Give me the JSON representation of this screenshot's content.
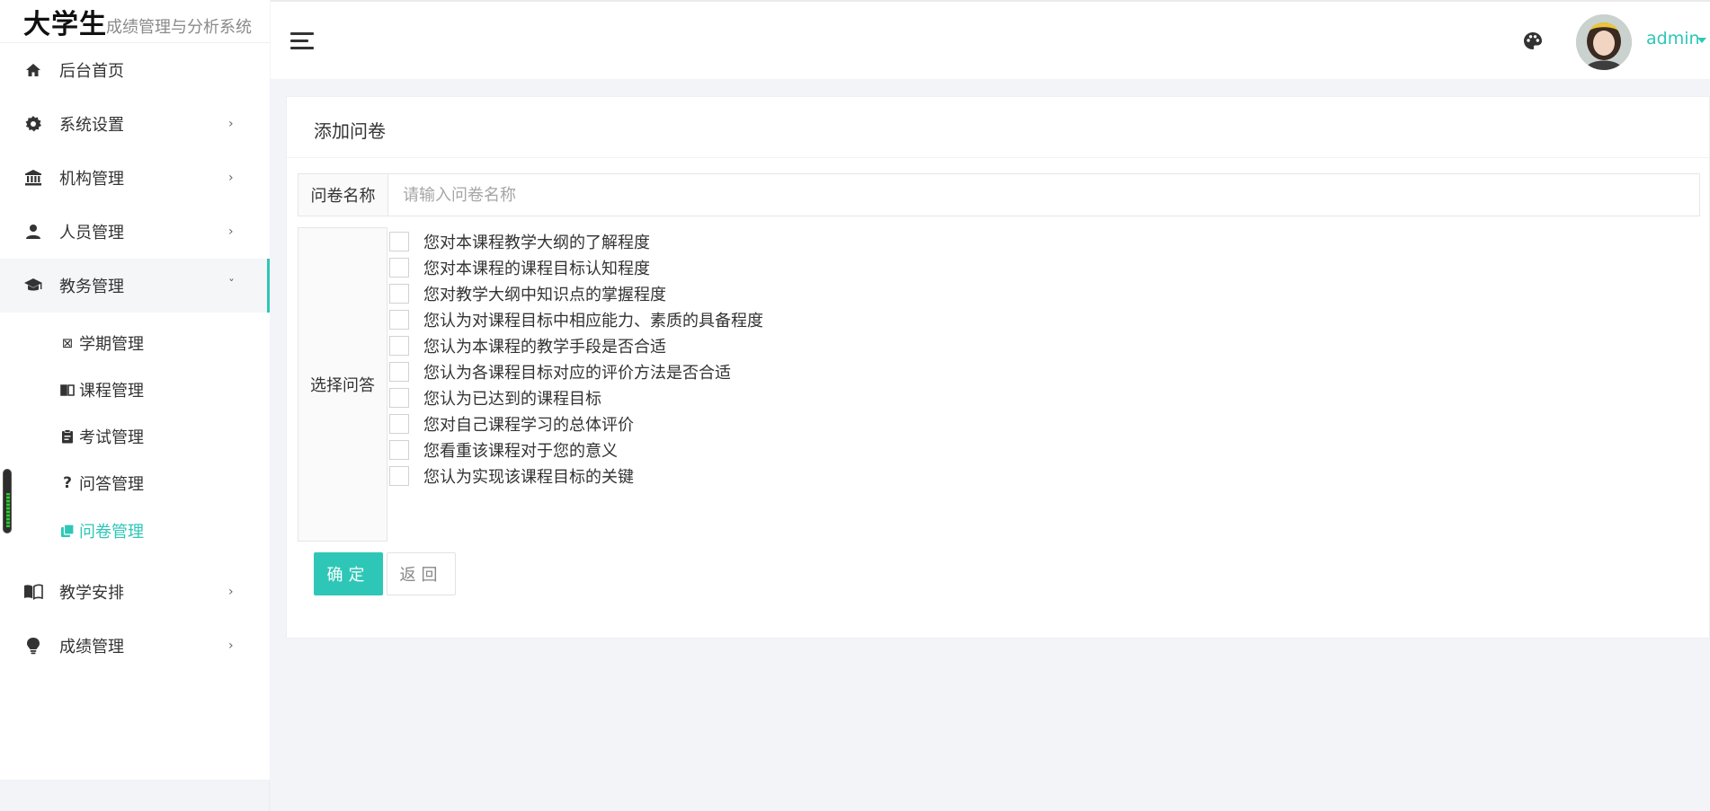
{
  "brand": {
    "title": "大学生",
    "subtitle": "成绩管理与分析系统"
  },
  "sidebar": {
    "items": [
      {
        "label": "后台首页",
        "icon": "home-icon"
      },
      {
        "label": "系统设置",
        "icon": "gear-icon"
      },
      {
        "label": "机构管理",
        "icon": "institution-icon"
      },
      {
        "label": "人员管理",
        "icon": "person-icon"
      },
      {
        "label": "教务管理",
        "icon": "graduation-cap-icon",
        "expanded": true
      },
      {
        "label": "教学安排",
        "icon": "book-open-icon"
      },
      {
        "label": "成绩管理",
        "icon": "lightbulb-icon"
      }
    ],
    "subitems": [
      {
        "label": "学期管理",
        "icon": "semester-icon"
      },
      {
        "label": "课程管理",
        "icon": "book-icon"
      },
      {
        "label": "考试管理",
        "icon": "clipboard-icon"
      },
      {
        "label": "问答管理",
        "icon": "question-icon"
      },
      {
        "label": "问卷管理",
        "icon": "copy-icon",
        "current": true
      }
    ]
  },
  "header": {
    "username": "admin"
  },
  "form": {
    "title": "添加问卷",
    "name_label": "问卷名称",
    "name_placeholder": "请输入问卷名称",
    "name_value": "",
    "choice_label": "选择问答",
    "options": [
      "您对本课程教学大纲的了解程度",
      "您对本课程的课程目标认知程度",
      "您对教学大纲中知识点的掌握程度",
      "您认为对课程目标中相应能力、素质的具备程度",
      "您认为本课程的教学手段是否合适",
      "您认为各课程目标对应的评价方法是否合适",
      "您认为已达到的课程目标",
      "您对自己课程学习的总体评价",
      "您看重该课程对于您的意义",
      "您认为实现该课程目标的关键"
    ],
    "confirm_label": "确定",
    "back_label": "返回"
  },
  "colors": {
    "accent": "#2ec7b7",
    "background": "#f3f4f8"
  }
}
